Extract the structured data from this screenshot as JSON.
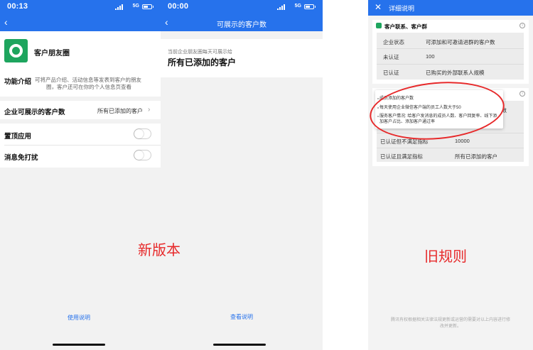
{
  "screen_new_detail": {
    "time": "00:13",
    "network": "5G",
    "app_name": "客户朋友圈",
    "feature_label": "功能介绍",
    "feature_desc_line1": "可将产品介绍、活动信息等发表到客户的朋友",
    "feature_desc_line2": "圈，客户还可在你的个人信息页查看",
    "visible_label": "企业可展示的客户数",
    "visible_value": "所有已添加的客户",
    "pin_label": "置顶应用",
    "mute_label": "消息免打扰",
    "pin_on": false,
    "mute_on": false,
    "help_link": "使用说明"
  },
  "screen_new_visible": {
    "time": "00:00",
    "network": "5G",
    "title": "可展示的客户数",
    "small_text": "当前企业朋友圈每天可展示给",
    "big_text": "所有已添加的客户",
    "help_link": "查看说明"
  },
  "screen_old_rules": {
    "title": "详细说明",
    "section1_title": "客户联系、客户群",
    "table1": [
      [
        "企业状态",
        "可添加和可邀请进群的客户数"
      ],
      [
        "未认证",
        "100"
      ],
      [
        "已认证",
        "已购买的外部联系人规模"
      ]
    ],
    "table2_header_right": "户数",
    "table2": [
      [
        "已认证但不满足指标",
        "10000"
      ],
      [
        "已认证且满足指标",
        "所有已添加的客户"
      ]
    ],
    "tooltip_title": "成员添加的客户数",
    "tooltip_items": [
      "每天使用企业微信客户端的员工人数大于50",
      "服务客户情况: 给客户发消息的成员人数、客户回复率、线下添加客户占比、添加客户通过率"
    ],
    "footer_note_line1": "腾讯有权根据相关法律法规更新或运营的需要对以上内容进行修",
    "footer_note_line2": "改并更新。"
  },
  "annotations": {
    "new_version": "新版本",
    "old_rules": "旧规则"
  },
  "colors": {
    "brand_blue": "#2672ec",
    "wechat_green": "#1ea55e",
    "annotation_red": "#e7292a"
  }
}
